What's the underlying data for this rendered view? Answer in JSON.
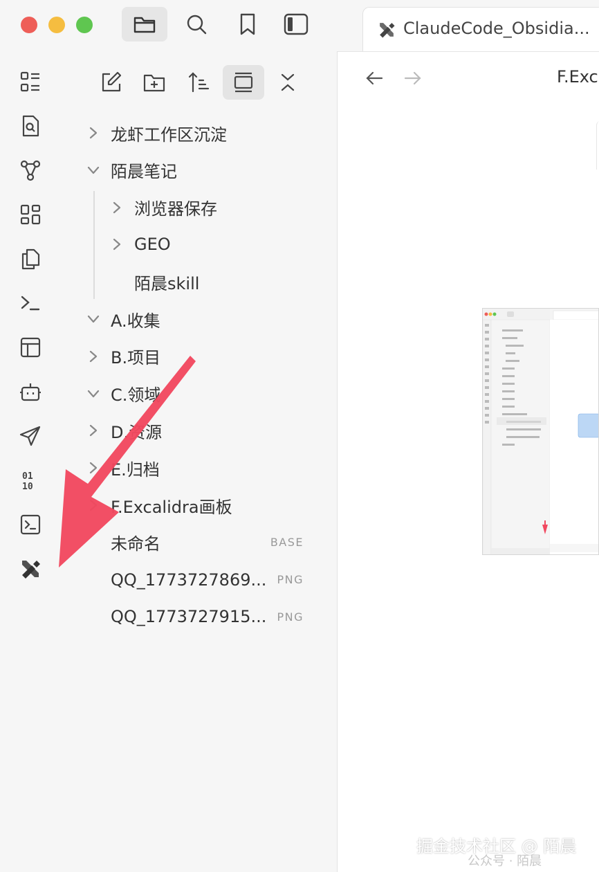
{
  "colors": {
    "close": "#ee5e58",
    "minimize": "#f5bd40",
    "zoom": "#5fc650",
    "arrow": "#f1485f",
    "accent": "#333333"
  },
  "toolbar": {
    "buttons": [
      {
        "icon": "folder-icon",
        "active": true
      },
      {
        "icon": "search-icon",
        "active": false
      },
      {
        "icon": "bookmark-icon",
        "active": false
      },
      {
        "icon": "sidebar-toggle-icon",
        "active": false
      }
    ]
  },
  "ribbon": {
    "icons": [
      "list-icon",
      "file-search-icon",
      "graph-icon",
      "grid-icon",
      "copy-icon",
      "terminal-prompt-icon",
      "layout-icon",
      "bot-icon",
      "send-icon",
      "binary-icon",
      "terminal-icon",
      "excalidraw-icon"
    ]
  },
  "sidebar": {
    "tools": [
      "new-note-icon",
      "new-folder-icon",
      "sort-icon",
      "collapse-view-icon",
      "close-all-icon"
    ],
    "tree": [
      {
        "label": "龙虾工作区沉淀",
        "chevron": "right",
        "level": 0
      },
      {
        "label": "陌晨笔记",
        "chevron": "down",
        "level": 0
      },
      {
        "label": "浏览器保存",
        "chevron": "right",
        "level": 1
      },
      {
        "label": "GEO",
        "chevron": "right",
        "level": 1
      },
      {
        "label": "陌晨skill",
        "chevron": "none",
        "level": 1
      },
      {
        "label": "A.收集",
        "chevron": "down",
        "level": 0
      },
      {
        "label": "B.项目",
        "chevron": "right",
        "level": 0
      },
      {
        "label": "C.领域",
        "chevron": "down",
        "level": 0
      },
      {
        "label": "D.资源",
        "chevron": "right",
        "level": 0
      },
      {
        "label": "E.归档",
        "chevron": "right",
        "level": 0
      },
      {
        "label": "F.Excalidra画板",
        "chevron": "right",
        "level": 0
      },
      {
        "label": "未命名",
        "chevron": "none",
        "level": 0,
        "badge": "BASE"
      },
      {
        "label": "QQ_1773727869...",
        "chevron": "none",
        "level": 0,
        "badge": "PNG"
      },
      {
        "label": "QQ_1773727915...",
        "chevron": "none",
        "level": 0,
        "badge": "PNG"
      }
    ]
  },
  "tab": {
    "title": "ClaudeCode_Obsidia...",
    "icon": "excalidraw-icon"
  },
  "main": {
    "breadcrumb": "F.Exc"
  },
  "watermark": {
    "text": "掘金技术社区 @ 陌晨",
    "sub": "公众号 · 陌晨"
  }
}
